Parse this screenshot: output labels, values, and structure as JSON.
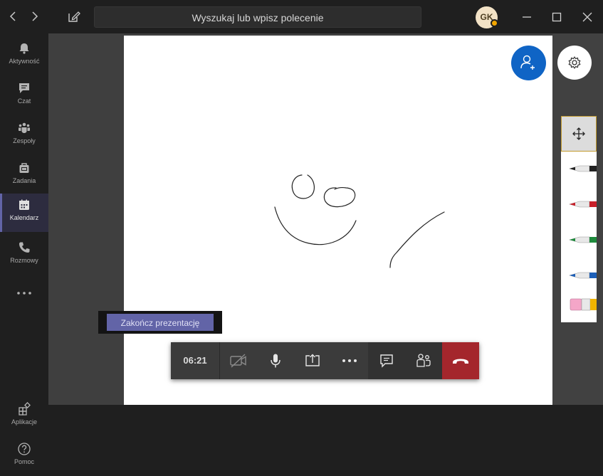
{
  "search": {
    "placeholder": "Wyszukaj lub wpisz polecenie"
  },
  "user": {
    "initials": "GK"
  },
  "sidebar": {
    "items": [
      {
        "label": "Aktywność",
        "icon": "bell-icon"
      },
      {
        "label": "Czat",
        "icon": "chat-icon"
      },
      {
        "label": "Zespoły",
        "icon": "teams-icon"
      },
      {
        "label": "Zadania",
        "icon": "tasks-icon"
      },
      {
        "label": "Kalendarz",
        "icon": "calendar-icon",
        "active": true
      },
      {
        "label": "Rozmowy",
        "icon": "phone-icon"
      }
    ],
    "bottom": [
      {
        "label": "Aplikacje",
        "icon": "apps-icon"
      },
      {
        "label": "Pomoc",
        "icon": "help-icon"
      }
    ]
  },
  "presentation": {
    "end_label": "Zakończ prezentację"
  },
  "call": {
    "duration": "06:21"
  },
  "tools": [
    "move-tool",
    "black-pen",
    "red-pen",
    "green-pen",
    "blue-pen",
    "eraser"
  ],
  "colors": {
    "accent": "#6264a7",
    "hangup": "#a4262c",
    "add_people": "#0f64c5"
  }
}
